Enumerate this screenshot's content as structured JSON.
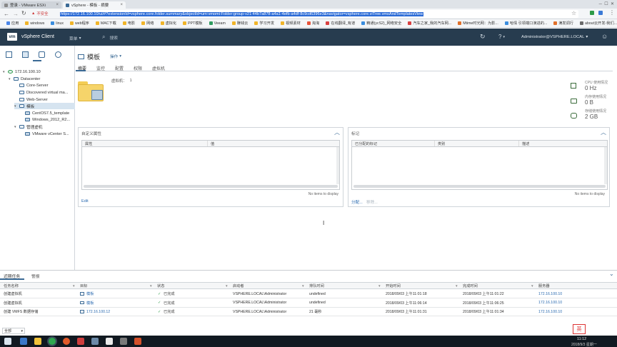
{
  "browser": {
    "tabs": [
      {
        "title": "登录 - VMware ESXi",
        "active": false
      },
      {
        "title": "vSphere - 模板 - 摘要",
        "active": true
      }
    ],
    "security_label": "不安全",
    "url": "https://172.16.100.10/ui/#?extensionId=vsphere.core.folder.summary&objectId=urn:vmomi:Folder:group-v21:44b7a878-a4a1-4efb-a4df-8c9cd6396e3&navigator=vsphere.core.viTree.vmsAndTemplatesView",
    "bookmarks": [
      "应用",
      "windows",
      "linux",
      "web程序",
      "MAC下载",
      "电影",
      "网络",
      "虚拟化",
      "PPT模板",
      "Veeam",
      "赚钱云",
      "学习开发",
      "视频素材",
      "淘淘",
      "在线翻译_有道",
      "精通(ycS2)_网络安全",
      "汽车之家_我的汽车网...",
      "Mtime时光网：为影...",
      "哈情 引领端口演进的...",
      "满发调行",
      "about云开发-我们..."
    ]
  },
  "vsphere": {
    "logo": "vm",
    "app_title": "vSphere Client",
    "menu_label": "菜单",
    "search_placeholder": "搜索",
    "user": "Administrator@VSPHERE.LOCAL"
  },
  "navigator": {
    "tree": [
      {
        "label": "172.16.100.10",
        "level": 0
      },
      {
        "label": "Datacenter",
        "level": 1
      },
      {
        "label": "Core-Server",
        "level": 2
      },
      {
        "label": "Discovered virtual ma...",
        "level": 2
      },
      {
        "label": "Web-Server",
        "level": 2
      },
      {
        "label": "模板",
        "level": 2,
        "selected": true
      },
      {
        "label": "CentOS7.5_template",
        "level": 3
      },
      {
        "label": "Windows_2012_R2...",
        "level": 3
      },
      {
        "label": "管理虚机",
        "level": 2
      },
      {
        "label": "VMware vCenter S...",
        "level": 3
      }
    ]
  },
  "object": {
    "title": "模板",
    "actions_label": "操作",
    "tabs": [
      "摘要",
      "监控",
      "配置",
      "权限",
      "虚拟机"
    ],
    "summary": {
      "vm_label": "虚拟机：",
      "vm_count": "1"
    },
    "usage": [
      {
        "label": "CPU 使用情况",
        "value": "0 Hz"
      },
      {
        "label": "内存使用情况",
        "value": "0 B"
      },
      {
        "label": "存储使用情况",
        "value": "2 GB"
      }
    ]
  },
  "custom_attributes": {
    "title": "自定义属性",
    "columns": [
      "属性",
      "值"
    ],
    "empty": "No items to display",
    "edit_link": "Edit"
  },
  "tags": {
    "title": "标记",
    "columns": [
      "已分配的标记",
      "类别",
      "描述"
    ],
    "empty": "No items to display",
    "assign_link": "分配...",
    "remove_link": "移除..."
  },
  "recent_tasks": {
    "tabs": [
      "近期任务",
      "警报"
    ],
    "columns": [
      "任务名称",
      "目标",
      "状态",
      "启动者",
      "排队时间",
      "开始时间",
      "完成时间",
      "服务器"
    ],
    "rows": [
      {
        "name": "创建虚拟机",
        "target": "模板",
        "status": "已完成",
        "initiator": "VSPHERE.LOCAL\\Administrator",
        "queued": "undefined",
        "start": "2018/09/03 上午11:01:18",
        "end": "2018/09/03 上午11:01:22",
        "server": "172.16.100.10"
      },
      {
        "name": "创建虚拟机",
        "target": "模板",
        "status": "已完成",
        "initiator": "VSPHERE.LOCAL\\Administrator",
        "queued": "undefined",
        "start": "2018/09/03 上午11:06:14",
        "end": "2018/09/03 上午11:06:25",
        "server": "172.16.100.10"
      },
      {
        "name": "创建 VMFS 数据存储",
        "target": "172.16.100.12",
        "status": "已完成",
        "initiator": "VSPHERE.LOCAL\\Administrator",
        "queued": "21 毫秒",
        "start": "2018/09/03 上午11:01:31",
        "end": "2018/09/03 上午11:01:34",
        "server": "172.16.100.10"
      }
    ],
    "filter_value": "全部"
  },
  "taskbar": {
    "time": "11:12",
    "date": "2018/9/3 星期一",
    "ime": "英"
  }
}
